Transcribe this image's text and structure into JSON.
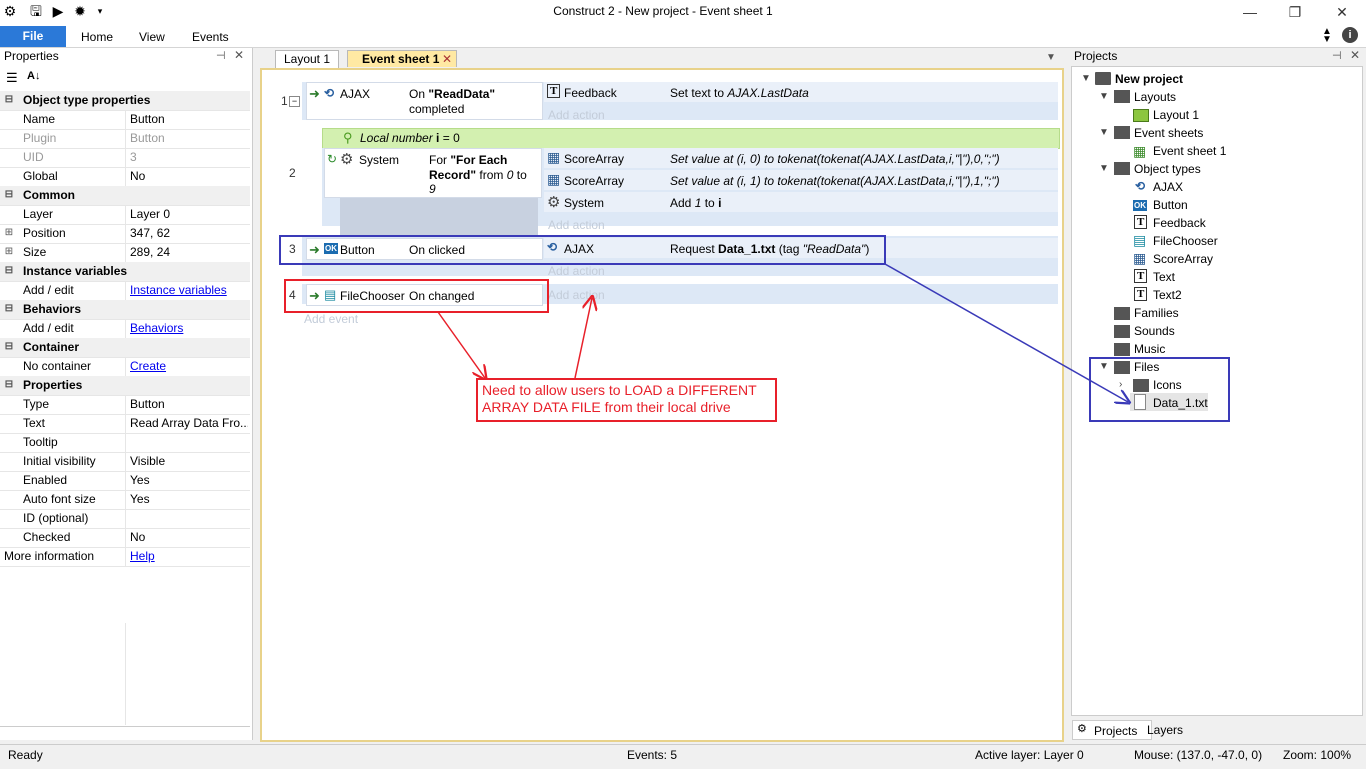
{
  "window": {
    "title": "Construct 2 - New project - Event sheet 1"
  },
  "ribbon": {
    "file": "File",
    "tabs": [
      "Home",
      "View",
      "Events"
    ]
  },
  "properties": {
    "title": "Properties",
    "rows": [
      {
        "type": "cat",
        "k": "Object type properties"
      },
      {
        "k": "Name",
        "v": "Button"
      },
      {
        "k": "Plugin",
        "v": "Button",
        "dim": true
      },
      {
        "k": "UID",
        "v": "3",
        "dim": true
      },
      {
        "k": "Global",
        "v": "No"
      },
      {
        "type": "cat",
        "k": "Common"
      },
      {
        "k": "Layer",
        "v": "Layer 0"
      },
      {
        "k": "Position",
        "v": "347, 62",
        "exp": true
      },
      {
        "k": "Size",
        "v": "289, 24",
        "exp": true
      },
      {
        "type": "cat",
        "k": "Instance variables"
      },
      {
        "k": "Add / edit",
        "v": "Instance variables",
        "link": true
      },
      {
        "type": "cat",
        "k": "Behaviors"
      },
      {
        "k": "Add / edit",
        "v": "Behaviors",
        "link": true
      },
      {
        "type": "cat",
        "k": "Container"
      },
      {
        "k": "No container",
        "v": "Create",
        "link": true
      },
      {
        "type": "cat",
        "k": "Properties"
      },
      {
        "k": "Type",
        "v": "Button"
      },
      {
        "k": "Text",
        "v": "Read Array Data Fro..."
      },
      {
        "k": "Tooltip",
        "v": ""
      },
      {
        "k": "Initial visibility",
        "v": "Visible"
      },
      {
        "k": "Enabled",
        "v": "Yes"
      },
      {
        "k": "Auto font size",
        "v": "Yes"
      },
      {
        "k": "ID (optional)",
        "v": ""
      },
      {
        "k": "Checked",
        "v": "No"
      },
      {
        "k": "More information",
        "v": "Help",
        "link": true,
        "noindent": true
      }
    ]
  },
  "center": {
    "tabs": [
      "Layout 1",
      "Event sheet 1"
    ]
  },
  "events": {
    "e1": {
      "num": "1",
      "object": "AJAX",
      "cond_a": "On ",
      "cond_b": "\"ReadData\"",
      "cond_c": "completed",
      "act_object": "Feedback",
      "act_text_a": "Set text to ",
      "act_text_b": "AJAX.LastData",
      "add_action": "Add action"
    },
    "local": {
      "label": "Local number ",
      "name": "i",
      "rest": " = 0"
    },
    "e2": {
      "num": "2",
      "object": "System",
      "cond_l1a": "For ",
      "cond_l1b": "\"For Each",
      "cond_l2a": "Record\"",
      "cond_l2b": " from ",
      "cond_l2c": "0",
      "cond_l2d": " to",
      "cond_l3": "9",
      "actions": [
        {
          "object": "ScoreArray",
          "text": "Set value at (i, 0) to tokenat(tokenat(AJAX.LastData,i,\"|\"),0,\";\")"
        },
        {
          "object": "ScoreArray",
          "text": "Set value at (i, 1) to tokenat(tokenat(AJAX.LastData,i,\"|\"),1,\";\")"
        },
        {
          "object": "System",
          "text_a": "Add ",
          "text_b": "1",
          "text_c": " to ",
          "text_d": "i"
        }
      ],
      "add_action": "Add action"
    },
    "e3": {
      "num": "3",
      "object": "Button",
      "cond": "On clicked",
      "act_object": "AJAX",
      "act_a": "Request ",
      "act_b": "Data_1.txt",
      "act_c": " (tag ",
      "act_d": "\"ReadData\"",
      "act_e": ")",
      "add_action": "Add action"
    },
    "e4": {
      "num": "4",
      "object": "FileChooser",
      "cond": "On changed",
      "add_action": "Add action"
    },
    "add_event": "Add event"
  },
  "annotation": {
    "line1": "Need to allow users to LOAD a DIFFERENT",
    "line2": "ARRAY DATA FILE from their local drive"
  },
  "projects": {
    "title": "Projects",
    "tree": {
      "root": "New project",
      "layouts": "Layouts",
      "layout1": "Layout 1",
      "eventsheets": "Event sheets",
      "eventsheet1": "Event sheet 1",
      "objecttypes": "Object types",
      "objects": [
        "AJAX",
        "Button",
        "Feedback",
        "FileChooser",
        "ScoreArray",
        "Text",
        "Text2"
      ],
      "families": "Families",
      "sounds": "Sounds",
      "music": "Music",
      "files": "Files",
      "icons": "Icons",
      "data": "Data_1.txt"
    },
    "bottom_tabs": [
      "Projects",
      "Layers"
    ]
  },
  "status": {
    "ready": "Ready",
    "events": "Events: 5",
    "layer": "Active layer: Layer 0",
    "mouse": "Mouse: (137.0, -47.0, 0)",
    "zoom": "Zoom: 100%"
  }
}
